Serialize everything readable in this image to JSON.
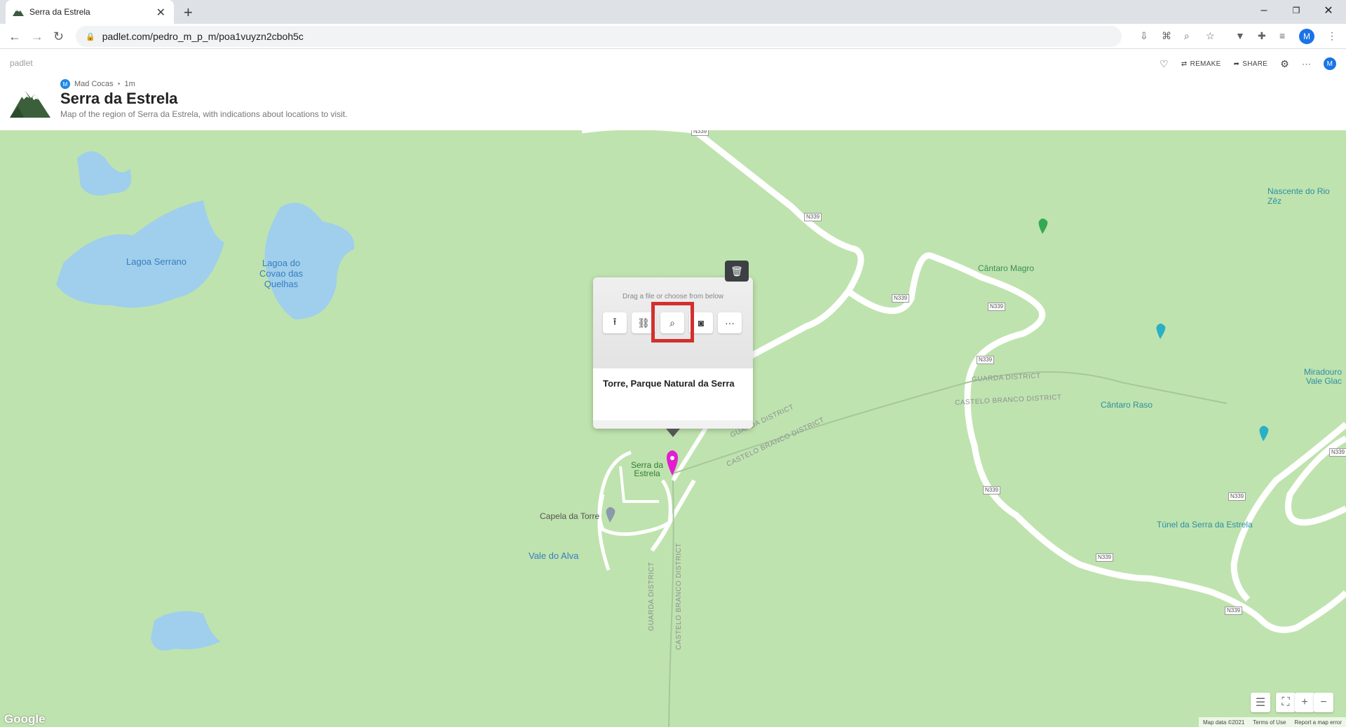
{
  "browser": {
    "tab_title": "Serra da Estrela",
    "new_tab": "+",
    "tab_close": "✕",
    "url": "padlet.com/pedro_m_p_m/poa1vuyzn2cboh5c",
    "profile_initial": "M",
    "window_controls": [
      "–",
      "❐",
      "✕"
    ]
  },
  "header": {
    "brand": "padlet",
    "author": "Mad Cocas",
    "author_initial": "M",
    "time": "1m",
    "title": "Serra da Estrela",
    "description": "Map of the region of Serra da Estrela, with indications about locations to visit.",
    "remake": "REMAKE",
    "share": "SHARE",
    "more": "···",
    "user_initial": "M"
  },
  "map": {
    "lakes": [
      "Lagoa Serrano",
      "Lagoa do\nCovao das\nQuelhas"
    ],
    "places": {
      "cantaro_magro": "Cântaro Magro",
      "cantaro_raso": "Cântaro Raso",
      "nascente": "Nascente do Rio Zêz",
      "miradouro": "Miradouro\nVale Glac",
      "tunel": "Túnel da Serra da Estrela",
      "capela": "Capela da Torre",
      "vale_alva": "Vale do Alva",
      "serra_estrela": "Serra da\nEstrela"
    },
    "road": "N339",
    "districts": {
      "guarda": "GUARDA DISTRICT",
      "castelo": "CASTELO BRANCO DISTRICT"
    },
    "footer": [
      "Map data ©2021",
      "Terms of Use",
      "Report a map error"
    ],
    "google": "Google"
  },
  "popup": {
    "hint": "Drag a file or choose from below",
    "text": "Torre, Parque Natural da Serra",
    "buttons": [
      "upload",
      "link",
      "search",
      "camera",
      "more"
    ]
  },
  "controls": {
    "zoom_in": "+",
    "zoom_out": "−"
  }
}
